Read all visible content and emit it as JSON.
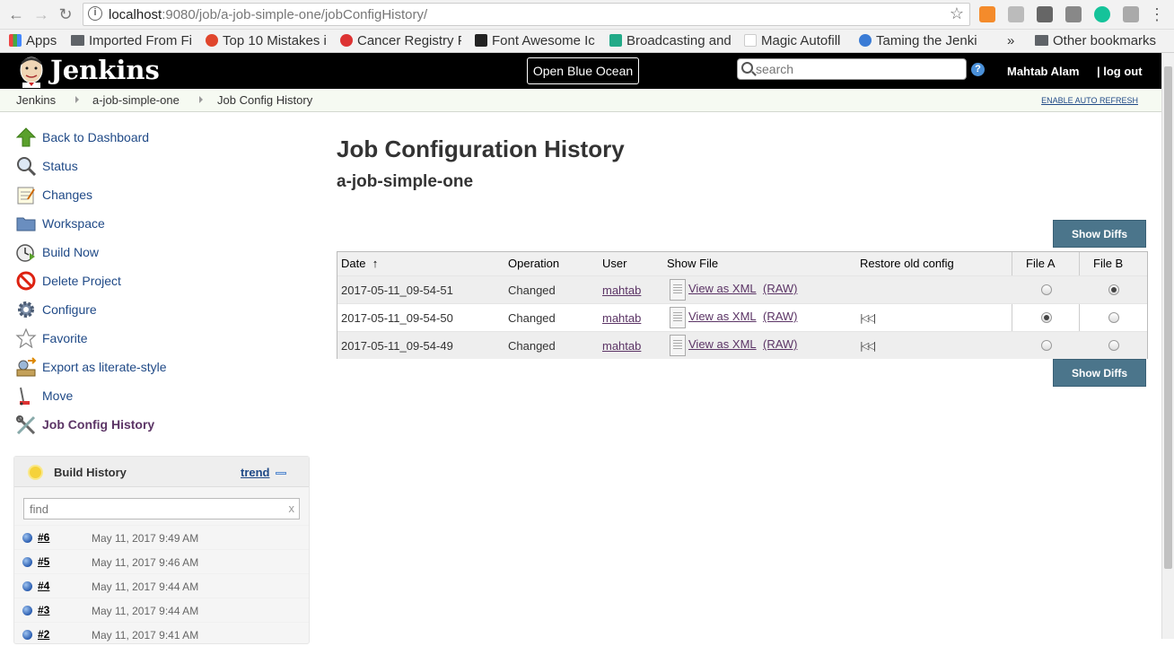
{
  "browser": {
    "url_host": "localhost",
    "url_rest": ":9080/job/a-job-simple-one/jobConfigHistory/",
    "bookmarks": [
      {
        "label": "Apps"
      },
      {
        "label": "Imported From Fi"
      },
      {
        "label": "Top 10 Mistakes i"
      },
      {
        "label": "Cancer Registry F"
      },
      {
        "label": "Font Awesome Ic"
      },
      {
        "label": "Broadcasting and"
      },
      {
        "label": "Magic Autofill"
      },
      {
        "label": "Taming the Jenki"
      },
      {
        "label": "»"
      },
      {
        "label": "Other bookmarks"
      }
    ]
  },
  "header": {
    "logo_text": "Jenkins",
    "blue_ocean": "Open Blue Ocean",
    "search_placeholder": "search",
    "help": "?",
    "user": "Mahtab Alam",
    "logout": "| log out"
  },
  "breadcrumb": {
    "items": [
      "Jenkins",
      "a-job-simple-one",
      "Job Config History"
    ],
    "auto_refresh": "ENABLE AUTO REFRESH"
  },
  "sidebar": {
    "tasks": [
      {
        "label": "Back to Dashboard",
        "icon": "up-arrow-icon"
      },
      {
        "label": "Status",
        "icon": "magnifier-icon"
      },
      {
        "label": "Changes",
        "icon": "notepad-icon"
      },
      {
        "label": "Workspace",
        "icon": "folder-icon"
      },
      {
        "label": "Build Now",
        "icon": "clock-icon"
      },
      {
        "label": "Delete Project",
        "icon": "no-entry-icon"
      },
      {
        "label": "Configure",
        "icon": "gear-icon"
      },
      {
        "label": "Favorite",
        "icon": "star-icon"
      },
      {
        "label": "Export as literate-style",
        "icon": "export-icon"
      },
      {
        "label": "Move",
        "icon": "move-icon"
      },
      {
        "label": "Job Config History",
        "icon": "tools-icon"
      }
    ]
  },
  "build_history": {
    "title": "Build History",
    "trend": "trend",
    "find_placeholder": "find",
    "clear": "x",
    "builds": [
      {
        "num": "#6",
        "date": "May 11, 2017 9:49 AM"
      },
      {
        "num": "#5",
        "date": "May 11, 2017 9:46 AM"
      },
      {
        "num": "#4",
        "date": "May 11, 2017 9:44 AM"
      },
      {
        "num": "#3",
        "date": "May 11, 2017 9:44 AM"
      },
      {
        "num": "#2",
        "date": "May 11, 2017 9:41 AM"
      }
    ]
  },
  "main": {
    "title": "Job Configuration History",
    "subtitle": "a-job-simple-one",
    "show_diffs": "Show Diffs",
    "columns": {
      "date": "Date",
      "sort": "↑",
      "operation": "Operation",
      "user": "User",
      "show_file": "Show File",
      "restore": "Restore old config",
      "file_a": "File A",
      "file_b": "File B"
    },
    "rows": [
      {
        "date": "2017-05-11_09-54-51",
        "operation": "Changed",
        "user": "mahtab",
        "xml": "View as XML",
        "raw": "(RAW)",
        "restore": false,
        "file_a": false,
        "file_b": true
      },
      {
        "date": "2017-05-11_09-54-50",
        "operation": "Changed",
        "user": "mahtab",
        "xml": "View as XML",
        "raw": "(RAW)",
        "restore": true,
        "file_a": true,
        "file_b": false
      },
      {
        "date": "2017-05-11_09-54-49",
        "operation": "Changed",
        "user": "mahtab",
        "xml": "View as XML",
        "raw": "(RAW)",
        "restore": true,
        "file_a": false,
        "file_b": false
      }
    ]
  },
  "colors": {
    "header_bg": "#000000",
    "link": "#204a87",
    "visited_link": "#5c3566",
    "button_bg": "#4b758b"
  }
}
